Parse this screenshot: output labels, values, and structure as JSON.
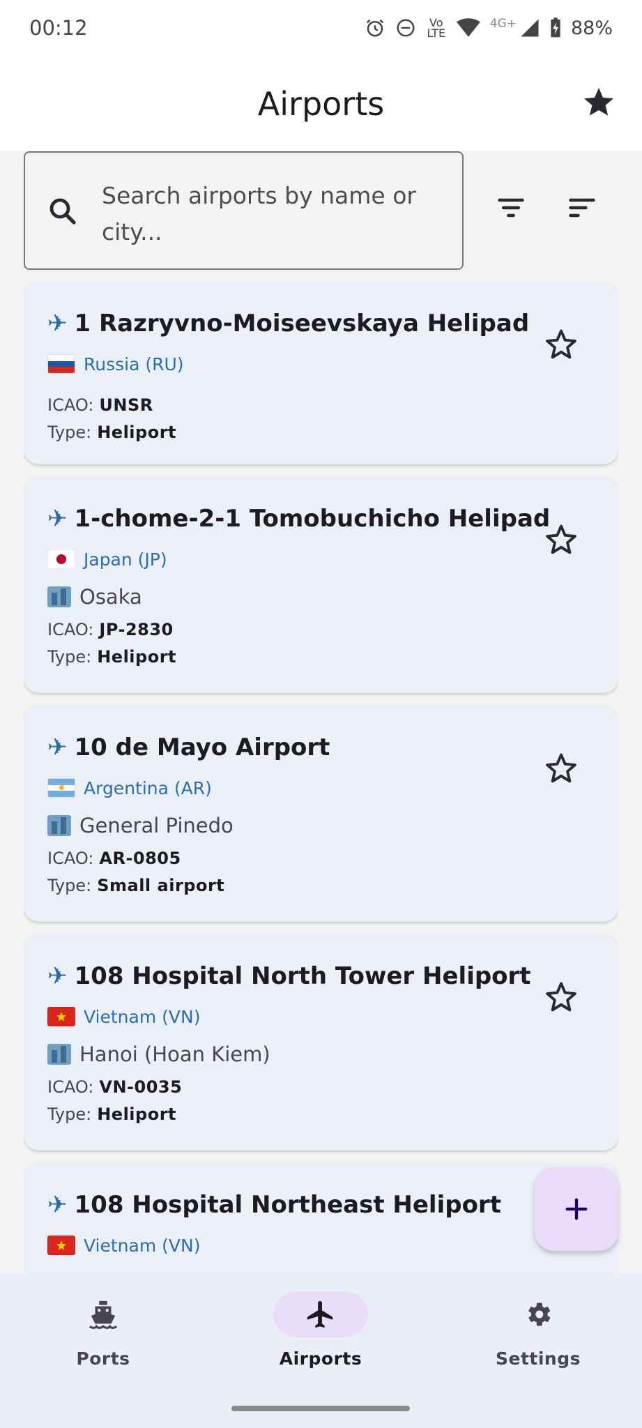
{
  "status_bar": {
    "time": "00:12",
    "volte": "Vo LTE",
    "network": "4G+",
    "battery": "88%"
  },
  "app_bar": {
    "title": "Airports",
    "favorites_icon": "star-filled-icon"
  },
  "search": {
    "placeholder": "Search airports by name or city..."
  },
  "airports": [
    {
      "name": "1 Razryvno-Moiseevskaya Helipad",
      "country": "Russia (RU)",
      "city": "",
      "icao_label": "ICAO:",
      "icao": "UNSR",
      "type_label": "Type:",
      "type": "Heliport"
    },
    {
      "name": "1-chome-2-1 Tomobuchicho Helipad",
      "country": "Japan (JP)",
      "city": "Osaka",
      "icao_label": "ICAO:",
      "icao": "JP-2830",
      "type_label": "Type:",
      "type": "Heliport"
    },
    {
      "name": "10 de Mayo Airport",
      "country": "Argentina (AR)",
      "city": "General Pinedo",
      "icao_label": "ICAO:",
      "icao": "AR-0805",
      "type_label": "Type:",
      "type": "Small airport"
    },
    {
      "name": "108 Hospital North Tower Heliport",
      "country": "Vietnam (VN)",
      "city": "Hanoi (Hoan Kiem)",
      "icao_label": "ICAO:",
      "icao": "VN-0035",
      "type_label": "Type:",
      "type": "Heliport"
    },
    {
      "name": "108 Hospital Northeast Heliport",
      "country": "Vietnam (VN)",
      "city": "",
      "icao_label": "",
      "icao": "",
      "type_label": "",
      "type": ""
    }
  ],
  "fab": {
    "icon": "plus-icon"
  },
  "bottom_nav": {
    "items": [
      {
        "label": "Ports",
        "icon": "ship-icon",
        "active": false
      },
      {
        "label": "Airports",
        "icon": "airplane-icon",
        "active": true
      },
      {
        "label": "Settings",
        "icon": "gear-icon",
        "active": false
      }
    ]
  },
  "colors": {
    "card_bg": "#ebf0f8",
    "country_link": "#2a6db3",
    "fab_bg": "#eadcf9",
    "nav_active_pill": "#e8def8"
  }
}
